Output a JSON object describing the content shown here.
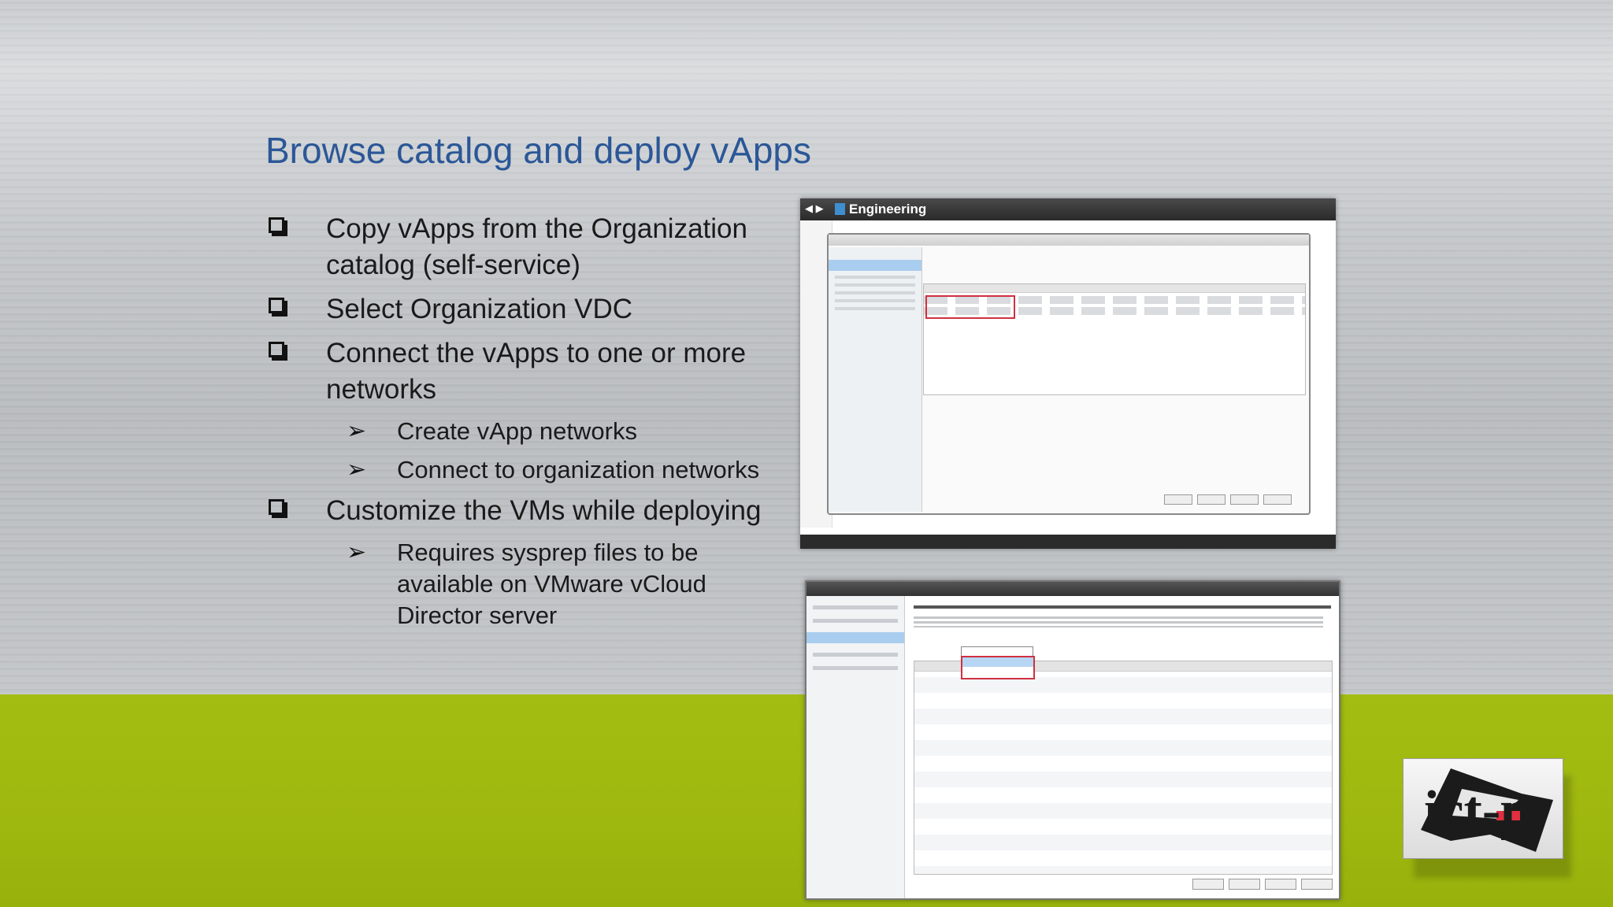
{
  "slide": {
    "title": "Browse catalog and deploy vApps",
    "bullets": [
      {
        "text": "Copy vApps from the Organization catalog (self-service)",
        "level": 1
      },
      {
        "text": "Select Organization VDC",
        "level": 1
      },
      {
        "text": "Connect the vApps to one or more networks",
        "level": 1
      },
      {
        "text": "Create vApp networks",
        "level": 2
      },
      {
        "text": "Connect to organization networks",
        "level": 2
      },
      {
        "text": "Customize the VMs while deploying",
        "level": 1
      },
      {
        "text": "Requires sysprep files to be available on VMware vCloud Director server",
        "level": 2
      }
    ]
  },
  "screenshot1": {
    "app_title": "Engineering",
    "nav_glyph": "◀ ▶"
  },
  "logo": {
    "text": "ict-p"
  },
  "colors": {
    "title": "#2b5797",
    "footer_band": "#a3bd12",
    "highlight": "#d03040"
  }
}
